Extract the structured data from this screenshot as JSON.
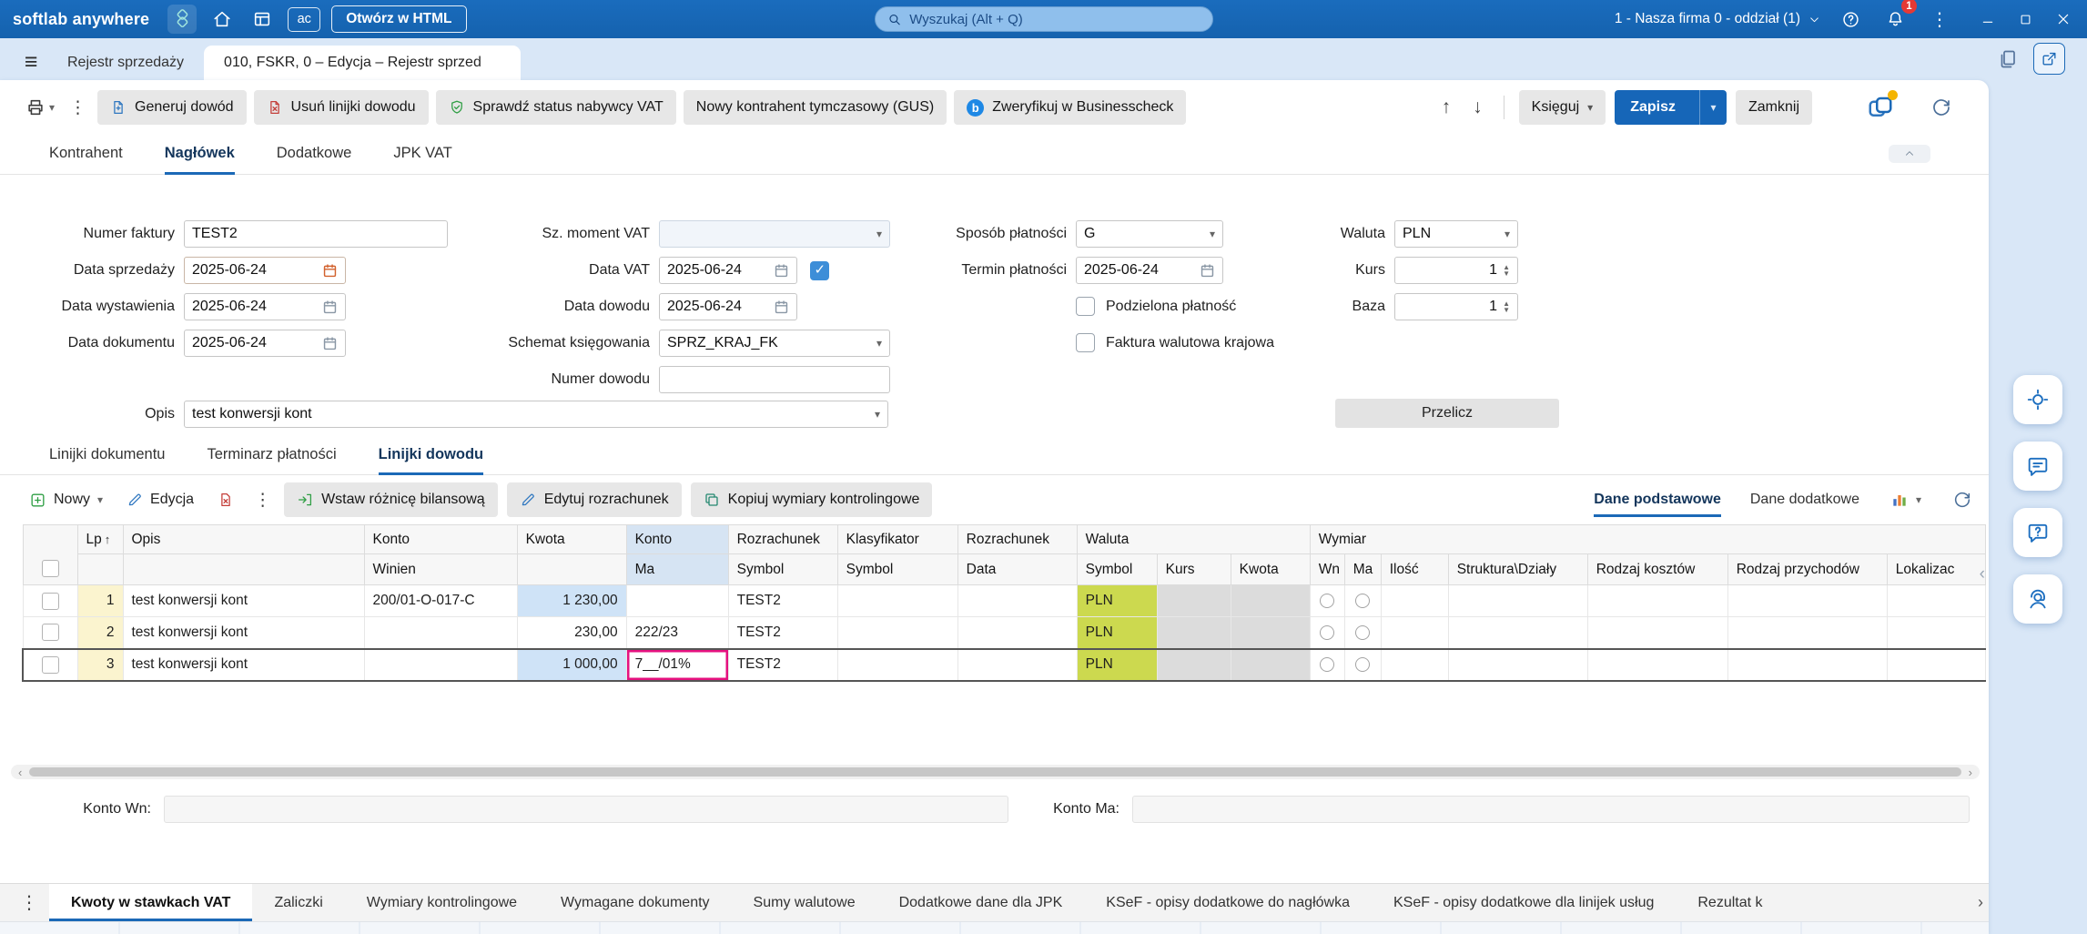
{
  "colors": {
    "accent": "#1b69b7",
    "save_button": "#1666b8",
    "pln_cell": "#ccd94f",
    "amount_cell": "#cfe3f7",
    "edit_border": "#e5117f"
  },
  "topbar": {
    "logo": "softlab anywhere",
    "ac_badge": "ac",
    "open_html": "Otwórz w HTML",
    "search_placeholder": "Wyszukaj (Alt + Q)",
    "company": "1 - Nasza firma 0 - oddział (1)",
    "notifications": "1"
  },
  "tabs": {
    "inactive": "Rejestr sprzedaży",
    "active": "010, FSKR, 0 – Edycja – Rejestr sprzed"
  },
  "toolbar": {
    "generate_proof": "Generuj dowód",
    "delete_proof_lines": "Usuń linijki dowodu",
    "check_buyer_vat": "Sprawdź status nabywcy VAT",
    "new_temp_contractor": "Nowy kontrahent tymczasowy (GUS)",
    "verify_businesscheck": "Zweryfikuj w Businesscheck",
    "post": "Księguj",
    "save": "Zapisz",
    "close": "Zamknij"
  },
  "header_tabs": [
    "Kontrahent",
    "Nagłówek",
    "Dodatkowe",
    "JPK VAT"
  ],
  "form": {
    "invoice_number": {
      "label": "Numer faktury",
      "value": "TEST2"
    },
    "vat_moment": {
      "label": "Sz. moment VAT",
      "value": ""
    },
    "payment_method": {
      "label": "Sposób płatności",
      "value": "G"
    },
    "currency": {
      "label": "Waluta",
      "value": "PLN"
    },
    "sale_date": {
      "label": "Data sprzedaży",
      "value": "2025-06-24"
    },
    "vat_date": {
      "label": "Data VAT",
      "value": "2025-06-24"
    },
    "payment_due": {
      "label": "Termin płatności",
      "value": "2025-06-24"
    },
    "rate": {
      "label": "Kurs",
      "value": "1"
    },
    "issue_date": {
      "label": "Data wystawienia",
      "value": "2025-06-24"
    },
    "proof_date": {
      "label": "Data dowodu",
      "value": "2025-06-24"
    },
    "split_payment": {
      "label": "Podzielona płatność"
    },
    "base": {
      "label": "Baza",
      "value": "1"
    },
    "document_date": {
      "label": "Data dokumentu",
      "value": "2025-06-24"
    },
    "posting_schema": {
      "label": "Schemat księgowania",
      "value": "SPRZ_KRAJ_FK"
    },
    "domestic_currency_invoice": {
      "label": "Faktura walutowa krajowa"
    },
    "proof_number": {
      "label": "Numer dowodu",
      "value": ""
    },
    "description": {
      "label": "Opis",
      "value": "test konwersji kont"
    },
    "recalculate": "Przelicz"
  },
  "section_tabs": [
    "Linijki dokumentu",
    "Terminarz płatności",
    "Linijki dowodu"
  ],
  "grid_toolbar": {
    "new": "Nowy",
    "edit": "Edycja",
    "insert_balance_diff": "Wstaw różnicę bilansową",
    "edit_settlement": "Edytuj rozrachunek",
    "copy_controlling_dims": "Kopiuj wymiary kontrolingowe",
    "basic_data": "Dane podstawowe",
    "additional_data": "Dane dodatkowe"
  },
  "grid": {
    "head": {
      "lp": "Lp",
      "opis": "Opis",
      "konto": "Konto",
      "kwota": "Kwota",
      "konto2": "Konto",
      "rozrachunek": "Rozrachunek",
      "klasyfikator": "Klasyfikator",
      "rozrachunek2": "Rozrachunek",
      "waluta": "Waluta",
      "wymiar": "Wymiar",
      "winien": "Winien",
      "ma": "Ma",
      "symbol": "Symbol",
      "symbol2": "Symbol",
      "data": "Data",
      "symbol3": "Symbol",
      "kurs": "Kurs",
      "kwota2": "Kwota",
      "wn": "Wn",
      "ma2": "Ma",
      "ilosc": "Ilość",
      "struktura": "Struktura\\Działy",
      "rodzaj_kosztow": "Rodzaj kosztów",
      "rodzaj_przychodow": "Rodzaj przychodów",
      "lokalizacja": "Lokalizac"
    },
    "rows": [
      {
        "lp": "1",
        "opis": "test konwersji kont",
        "winien": "200/01-O-017-C",
        "kwota": "1 230,00",
        "ma": "",
        "symbol": "TEST2",
        "waluta": "PLN"
      },
      {
        "lp": "2",
        "opis": "test konwersji kont",
        "winien": "",
        "kwota": "230,00",
        "ma": "222/23",
        "symbol": "TEST2",
        "waluta": "PLN"
      },
      {
        "lp": "3",
        "opis": "test konwersji kont",
        "winien": "",
        "kwota": "1 000,00",
        "ma": "7__/01%",
        "symbol": "TEST2",
        "waluta": "PLN"
      }
    ]
  },
  "footer": {
    "konto_wn": "Konto Wn:",
    "konto_ma": "Konto Ma:"
  },
  "bottom_tabs": [
    "Kwoty w stawkach VAT",
    "Zaliczki",
    "Wymiary kontrolingowe",
    "Wymagane dokumenty",
    "Sumy walutowe",
    "Dodatkowe dane dla JPK",
    "KSeF - opisy dodatkowe do nagłówka",
    "KSeF - opisy dodatkowe dla linijek usług",
    "Rezultat k"
  ]
}
